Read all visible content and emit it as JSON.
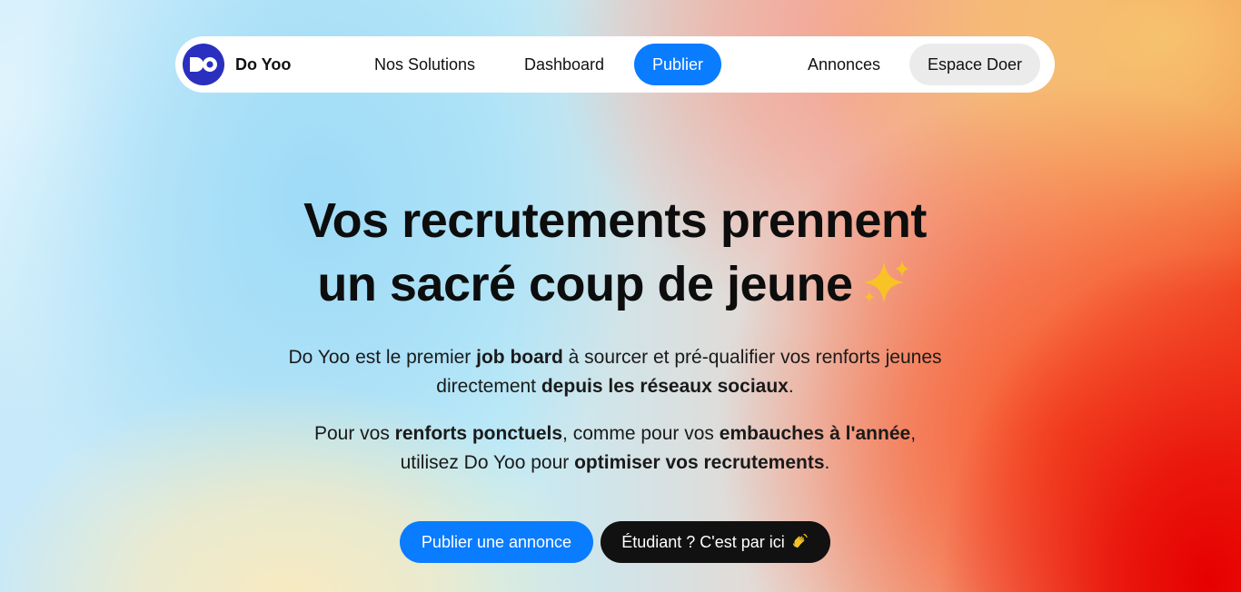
{
  "nav": {
    "brand": "Do Yoo",
    "logo_text": "DO",
    "items": [
      {
        "label": "Nos Solutions"
      },
      {
        "label": "Dashboard"
      },
      {
        "label": "Publier"
      },
      {
        "label": "Annonces"
      },
      {
        "label": "Espace Doer"
      }
    ]
  },
  "hero": {
    "title_line1": "Vos recrutements prennent",
    "title_line2": "un sacré coup de jeune",
    "title_icon": "sparkles-icon",
    "p1": {
      "a": "Do Yoo est le premier ",
      "b": "job board",
      "c": " à sourcer et pré-qualifier vos renforts jeunes",
      "d": "directement ",
      "e": "depuis les réseaux sociaux",
      "f": "."
    },
    "p2": {
      "a": "Pour vos ",
      "b": "renforts ponctuels",
      "c": ", comme pour vos ",
      "d": "embauches à l'année",
      "e": ",",
      "f": "utilisez Do Yoo pour ",
      "g": "optimiser vos recrutements",
      "h": "."
    }
  },
  "cta": {
    "primary": "Publier une annonce",
    "secondary": "Étudiant ? C'est par ici",
    "secondary_icon": "waving-hand-icon"
  },
  "colors": {
    "accent": "#0a7cff",
    "logo": "#2a2fbf",
    "dark_button": "#111111"
  }
}
